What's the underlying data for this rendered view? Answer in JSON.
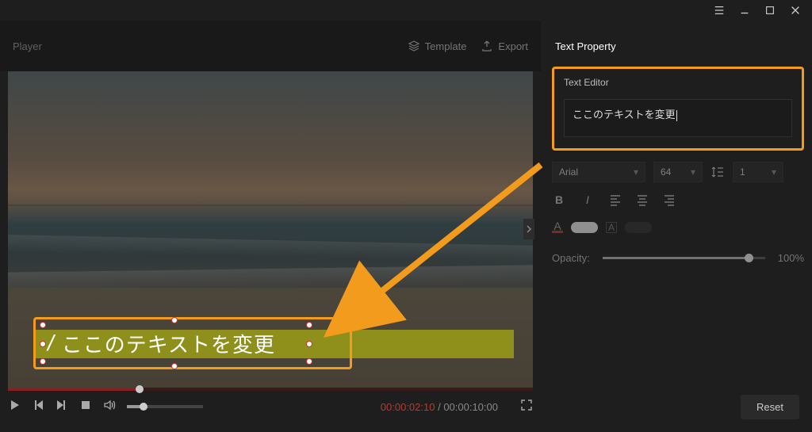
{
  "window": {
    "menu_icon": "menu",
    "min_icon": "min",
    "max_icon": "max",
    "close_icon": "close"
  },
  "topbar": {
    "player_label": "Player",
    "template_label": "Template",
    "export_label": "Export",
    "property_title": "Text Property"
  },
  "editor": {
    "label": "Text Editor",
    "value": "ここのテキストを変更"
  },
  "overlay": {
    "text": "ここのテキストを変更"
  },
  "font_controls": {
    "font_family": "Arial",
    "font_size": "64",
    "line_spacing": "1"
  },
  "opacity": {
    "label": "Opacity:",
    "value": "100%"
  },
  "time": {
    "current": "00:00:02:10",
    "sep": " / ",
    "total": "00:00:10:00"
  },
  "reset_label": "Reset"
}
